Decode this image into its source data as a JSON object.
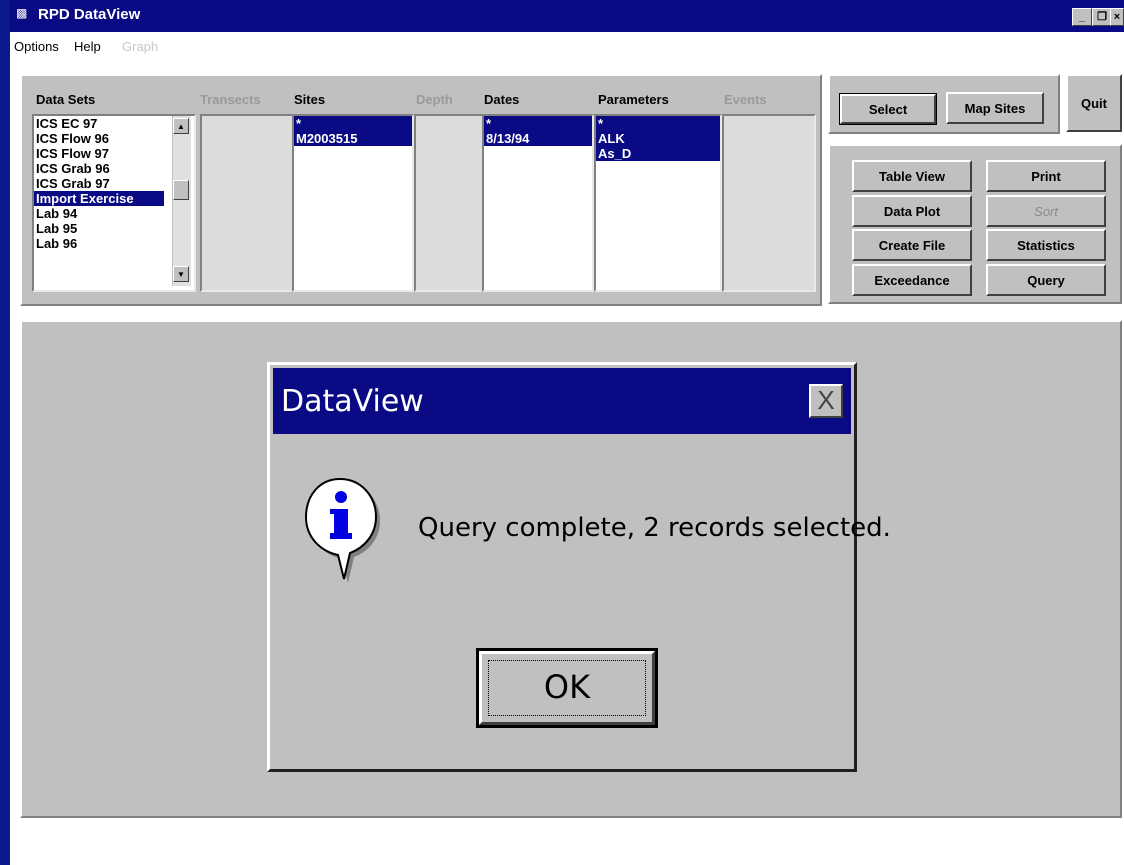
{
  "window": {
    "title": "RPD DataView"
  },
  "menu": {
    "options": "Options",
    "help": "Help",
    "graph": "Graph"
  },
  "columns": {
    "data_sets": "Data Sets",
    "transects": "Transects",
    "sites": "Sites",
    "depth": "Depth",
    "dates": "Dates",
    "parameters": "Parameters",
    "events": "Events"
  },
  "lists": {
    "data_sets": [
      "ICS EC 97",
      "ICS Flow 96",
      "ICS Flow 97",
      "ICS Grab 96",
      "ICS Grab 97",
      "Import Exercise",
      "Lab 94",
      "Lab 95",
      "Lab 96"
    ],
    "data_sets_selected": "Import Exercise",
    "sites": [
      "*",
      "M2003515"
    ],
    "dates": [
      "*",
      "8/13/94"
    ],
    "parameters": [
      "*",
      "ALK",
      "As_D"
    ]
  },
  "buttons": {
    "select": "Select",
    "map_sites": "Map Sites",
    "quit": "Quit",
    "table_view": "Table View",
    "print": "Print",
    "data_plot": "Data Plot",
    "sort": "Sort",
    "create_file": "Create File",
    "statistics": "Statistics",
    "exceedance": "Exceedance",
    "query": "Query"
  },
  "dialog": {
    "title": "DataView",
    "close_glyph": "X",
    "message": "Query complete, 2 records selected.",
    "ok": "OK",
    "icon": "info-icon"
  },
  "colors": {
    "titlebar": "#0a0a84",
    "selection": "#0a0a84",
    "face": "#c0c0c0"
  }
}
